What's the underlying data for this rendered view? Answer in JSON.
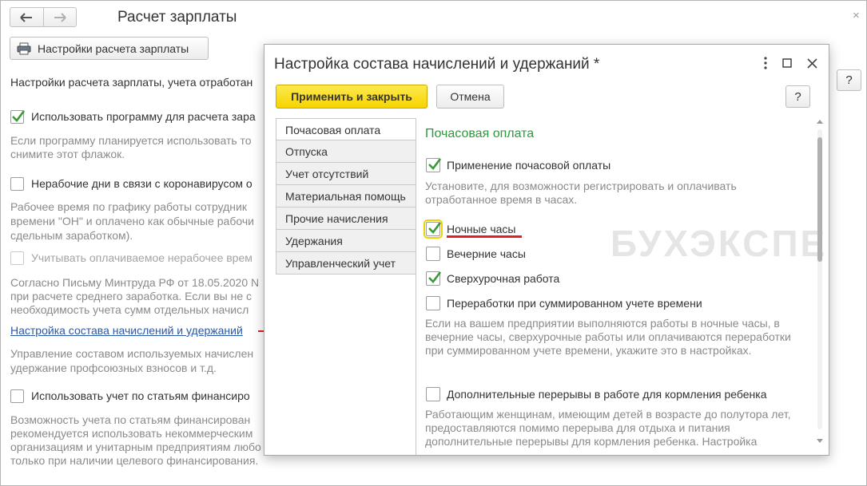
{
  "main": {
    "title": "Расчет зарплаты",
    "close": "×",
    "settings_button": "Настройки расчета зарплаты",
    "help": "?",
    "intro": "Настройки расчета зарплаты, учета отработан",
    "use_program_label": "Использовать программу для расчета зара",
    "use_program_desc": [
      "Если программу планируется использовать то",
      "снимите этот флажок."
    ],
    "nonworking_label": "Нерабочие дни в связи с коронавирусом о",
    "nonworking_desc": [
      "Рабочее время по графику работы сотрудник",
      "времени \"ОН\" и оплачено как обычные рабочи",
      "сдельным заработком)."
    ],
    "paid_nonworking_label": "Учитывать оплачиваемое нерабочее врем",
    "letter_desc": [
      "Согласно Письму Минтруда РФ от 18.05.2020 N",
      "при расчете среднего заработка. Если вы не с",
      "необходимость учета сумм отдельных начисл"
    ],
    "link": "Настройка состава начислений и удержаний",
    "link_desc": [
      "Управление составом используемых начислен",
      "удержание профсоюзных взносов и т.д."
    ],
    "finance_label": "Использовать учет по статьям финансиро",
    "finance_desc": [
      "Возможность учета по статьям финансирован",
      "рекомендуется использовать некоммерческим",
      "организациям и унитарным предприятиям любо",
      "только при наличии целевого финансирования."
    ]
  },
  "modal": {
    "title": "Настройка состава начислений и удержаний *",
    "apply_button": "Применить и закрыть",
    "cancel_button": "Отмена",
    "help": "?",
    "tabs": [
      {
        "label": "Почасовая оплата"
      },
      {
        "label": "Отпуска"
      },
      {
        "label": "Учет отсутствий"
      },
      {
        "label": "Материальная помощь"
      },
      {
        "label": "Прочие начисления"
      },
      {
        "label": "Удержания"
      },
      {
        "label": "Управленческий учет"
      }
    ],
    "section_title": "Почасовая оплата",
    "hourly_label": "Применение почасовой оплаты",
    "hourly_desc": "Установите, для возможности регистрировать и оплачивать отработанное время в часах.",
    "night_label": "Ночные часы",
    "evening_label": "Вечерние часы",
    "overtime_label": "Сверхурочная работа",
    "overwork_label": "Переработки при суммированном учете времени",
    "overwork_desc": "Если на вашем предприятии выполняются работы в ночные часы, в вечерние часы, сверхурочные работы или оплачиваются переработки при суммированном учете времени, укажите это в настройках.",
    "breaks_label": "Дополнительные перерывы в работе для кормления ребенка",
    "breaks_desc": "Работающим женщинам, имеющим детей в возрасте до полутора лет, предоставляются помимо перерыва для отдыха и питания дополнительные перерывы для кормления ребенка. Настройка",
    "watermark": "БУХЭКСПЕРТ"
  },
  "colors": {
    "accent_green": "#2d9a3e",
    "apply_yellow": "#f6d400",
    "link_blue": "#2a57a7",
    "annotation_red": "#e31e24",
    "checkmark_green": "#3a9a3a"
  },
  "icons": {
    "back": "arrow-left-icon",
    "forward": "arrow-right-icon",
    "printer": "printer-icon",
    "more": "more-vertical-icon",
    "maximize": "maximize-icon",
    "close": "close-icon",
    "check": "checkmark-icon"
  }
}
